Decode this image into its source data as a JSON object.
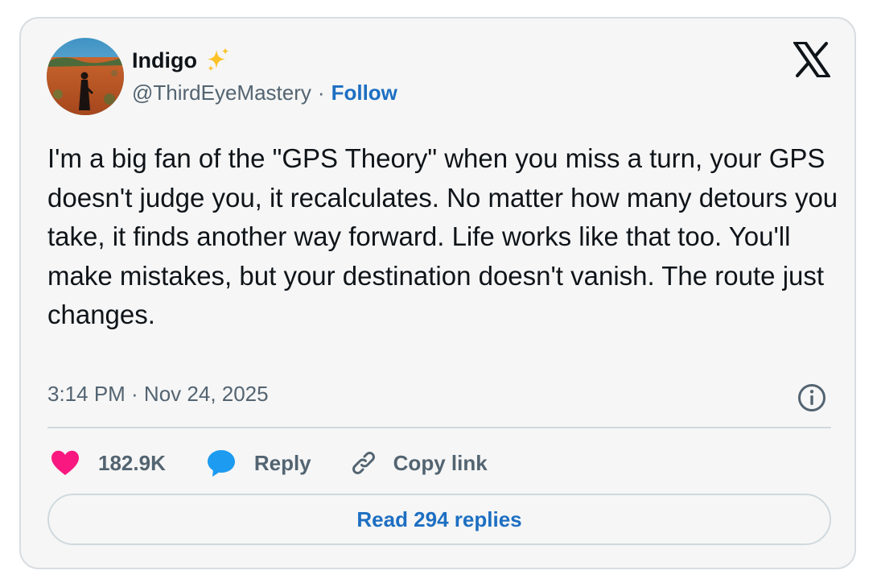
{
  "user": {
    "display_name": "Indigo",
    "name_emoji": "sparkles-icon",
    "handle": "@ThirdEyeMastery",
    "separator": "·",
    "follow_label": "Follow",
    "avatar": "avatar-photo"
  },
  "brand": {
    "logo": "x-logo-icon"
  },
  "tweet": {
    "text": "I'm a big fan of the \"GPS Theory\" when you miss a turn, your GPS doesn't judge you, it recalculates. No matter how many detours you take, it finds another way forward. Life works like that too. You'll make mistakes, but your destination doesn't vanish. The route just changes.",
    "timestamp": "3:14 PM · Nov 24, 2025",
    "info_icon": "info-icon"
  },
  "actions": {
    "like_count": "182.9K",
    "like_icon": "heart-icon",
    "reply_label": "Reply",
    "reply_icon": "speech-bubble-icon",
    "copy_label": "Copy link",
    "copy_icon": "link-icon"
  },
  "footer": {
    "read_replies_label": "Read 294 replies"
  },
  "colors": {
    "link_blue": "#1d6fc2",
    "heart_pink": "#f91880",
    "reply_blue": "#1d9bf0",
    "muted_text": "#536471",
    "card_background": "#f6f6f6",
    "border": "#cfd9de"
  }
}
